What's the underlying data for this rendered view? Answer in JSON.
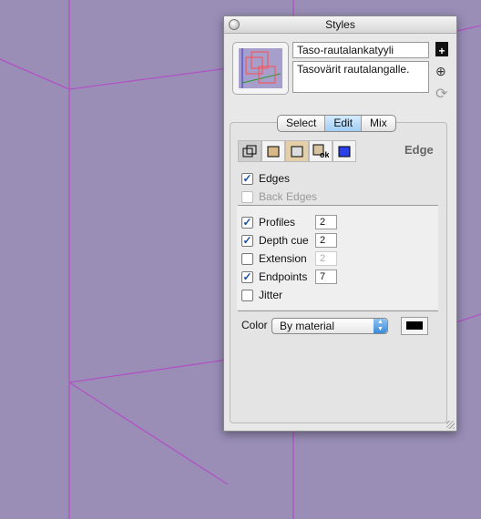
{
  "window": {
    "title": "Styles"
  },
  "style": {
    "name": "Taso-rautalankatyyli",
    "description": "Tasovärit rautalangalle."
  },
  "tabs": [
    {
      "label": "Select",
      "active": false
    },
    {
      "label": "Edit",
      "active": true
    },
    {
      "label": "Mix",
      "active": false
    }
  ],
  "section_title": "Edge",
  "settings_icons": [
    "edge-settings-icon",
    "face-settings-icon",
    "background-settings-icon",
    "watermark-settings-icon",
    "modeling-settings-icon"
  ],
  "options": {
    "edges": {
      "label": "Edges",
      "checked": true
    },
    "back_edges": {
      "label": "Back Edges",
      "checked": false,
      "enabled": false
    },
    "profiles": {
      "label": "Profiles",
      "checked": true,
      "value": "2"
    },
    "depth_cue": {
      "label": "Depth cue",
      "checked": true,
      "value": "2"
    },
    "extension": {
      "label": "Extension",
      "checked": false,
      "value": "2"
    },
    "endpoints": {
      "label": "Endpoints",
      "checked": true,
      "value": "7"
    },
    "jitter": {
      "label": "Jitter",
      "checked": false
    }
  },
  "color": {
    "label": "Color",
    "selected": "By material",
    "swatch": "#000000"
  },
  "colors": {
    "background": "#9a8eb7",
    "edge_lines": "#b152c4",
    "accent": "#3b8ad8"
  }
}
